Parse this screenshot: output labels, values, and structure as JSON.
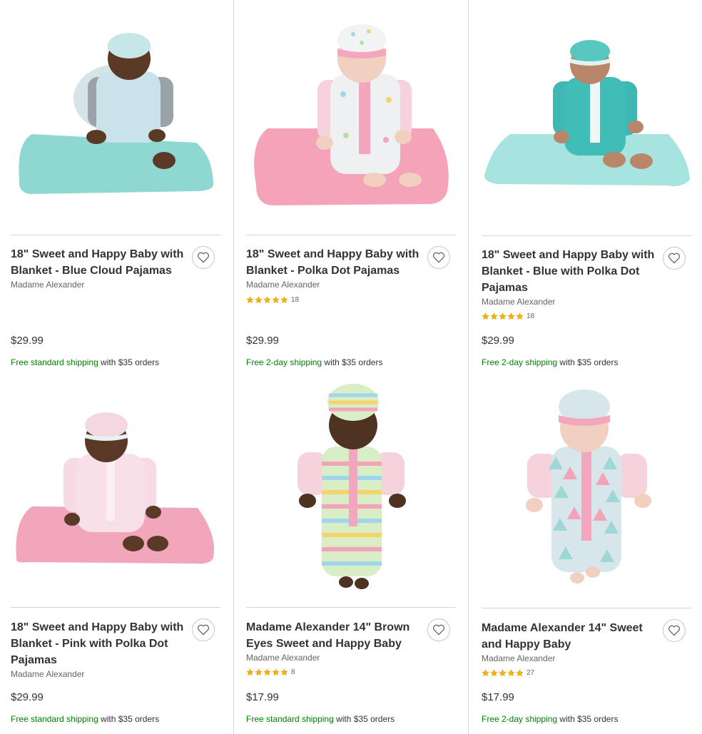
{
  "products": [
    {
      "title": "18\" Sweet and Happy Baby with Blanket - Blue Cloud Pajamas",
      "brand": "Madame Alexander",
      "rating_count": "",
      "price": "$29.99",
      "shipping_highlight": "Free standard shipping",
      "shipping_rest": " with $35 orders",
      "image_icon": "doll-dark-skin-blue-cloud-pajamas-blue-blanket"
    },
    {
      "title": "18\" Sweet and Happy Baby with Blanket - Polka Dot Pajamas",
      "brand": "Madame Alexander",
      "rating_count": "18",
      "price": "$29.99",
      "shipping_highlight": "Free 2-day shipping",
      "shipping_rest": " with $35 orders",
      "image_icon": "doll-light-skin-polka-dot-pajamas-pink-blanket"
    },
    {
      "title": "18\" Sweet and Happy Baby with Blanket - Blue with Polka Dot Pajamas",
      "brand": "Madame Alexander",
      "rating_count": "18",
      "price": "$29.99",
      "shipping_highlight": "Free 2-day shipping",
      "shipping_rest": " with $35 orders",
      "image_icon": "doll-teal-pajamas-blue-blanket"
    },
    {
      "title": "18\" Sweet and Happy Baby with Blanket - Pink with Polka Dot Pajamas",
      "brand": "Madame Alexander",
      "rating_count": "",
      "price": "$29.99",
      "shipping_highlight": "Free standard shipping",
      "shipping_rest": " with $35 orders",
      "image_icon": "doll-dark-skin-pink-pajamas-pink-blanket"
    },
    {
      "title": "Madame Alexander 14\" Brown Eyes Sweet and Happy Baby",
      "brand": "Madame Alexander",
      "rating_count": "8",
      "price": "$17.99",
      "shipping_highlight": "Free standard shipping",
      "shipping_rest": " with $35 orders",
      "image_icon": "doll-dark-skin-striped-pajamas"
    },
    {
      "title": "Madame Alexander 14\" Sweet and Happy Baby",
      "brand": "Madame Alexander",
      "rating_count": "27",
      "price": "$17.99",
      "shipping_highlight": "Free 2-day shipping",
      "shipping_rest": " with $35 orders",
      "image_icon": "doll-light-skin-triangle-pajamas"
    }
  ],
  "colors": {
    "shipping_green": "#008300",
    "star_gold": "#f5b400",
    "divider": "#d6d6d6"
  }
}
